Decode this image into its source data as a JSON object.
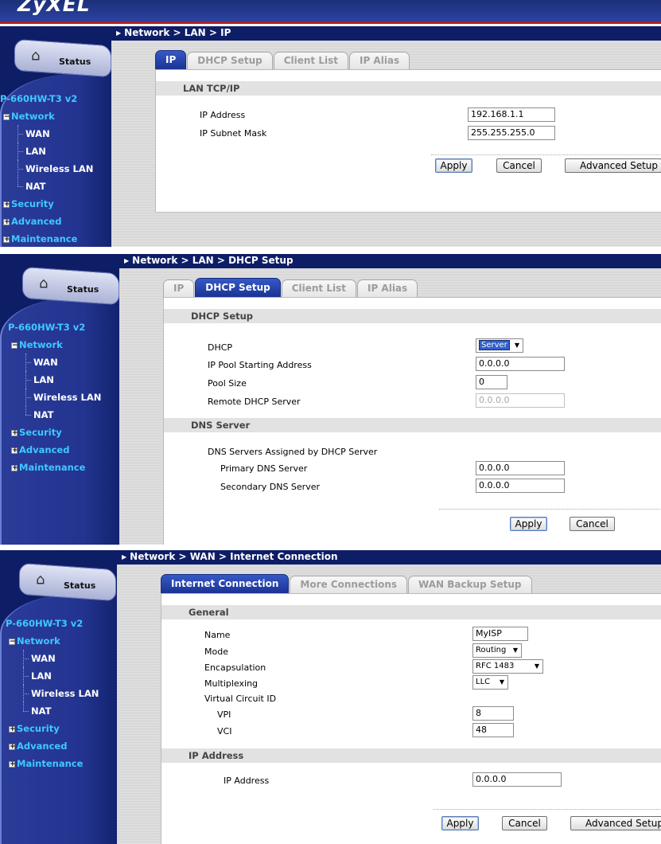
{
  "logo": "ZyXEL",
  "status_label": "Status",
  "model": "P-660HW-T3 v2",
  "nav": {
    "network": "Network",
    "wan": "WAN",
    "lan": "LAN",
    "wireless_lan": "Wireless LAN",
    "nat": "NAT",
    "security": "Security",
    "advanced": "Advanced",
    "maintenance": "Maintenance"
  },
  "buttons": {
    "apply": "Apply",
    "cancel": "Cancel",
    "advanced_setup": "Advanced Setup"
  },
  "panel1": {
    "breadcrumb": "Network > LAN > IP",
    "tabs": [
      "IP",
      "DHCP Setup",
      "Client List",
      "IP Alias"
    ],
    "section": "LAN TCP/IP",
    "ip_address_label": "IP Address",
    "ip_address_value": "192.168.1.1",
    "subnet_label": "IP Subnet Mask",
    "subnet_value": "255.255.255.0"
  },
  "panel2": {
    "breadcrumb": "Network > LAN > DHCP Setup",
    "tabs": [
      "IP",
      "DHCP Setup",
      "Client List",
      "IP Alias"
    ],
    "section_dhcp": "DHCP Setup",
    "dhcp_label": "DHCP",
    "dhcp_value": "Server",
    "pool_start_label": "IP Pool Starting Address",
    "pool_start_value": "0.0.0.0",
    "pool_size_label": "Pool Size",
    "pool_size_value": "0",
    "remote_dhcp_label": "Remote DHCP Server",
    "remote_dhcp_value": "0.0.0.0",
    "section_dns": "DNS Server",
    "dns_assigned_label": "DNS Servers Assigned by DHCP Server",
    "primary_dns_label": "Primary DNS Server",
    "primary_dns_value": "0.0.0.0",
    "secondary_dns_label": "Secondary DNS Server",
    "secondary_dns_value": "0.0.0.0"
  },
  "panel3": {
    "breadcrumb": "Network > WAN > Internet Connection",
    "tabs": [
      "Internet Connection",
      "More Connections",
      "WAN Backup Setup"
    ],
    "section_general": "General",
    "name_label": "Name",
    "name_value": "MyISP",
    "mode_label": "Mode",
    "mode_value": "Routing",
    "encap_label": "Encapsulation",
    "encap_value": "RFC 1483",
    "mux_label": "Multiplexing",
    "mux_value": "LLC",
    "vc_label": "Virtual Circuit ID",
    "vpi_label": "VPI",
    "vpi_value": "8",
    "vci_label": "VCI",
    "vci_value": "48",
    "section_ip": "IP Address",
    "ip_label": "IP Address",
    "ip_value": "0.0.0.0"
  }
}
